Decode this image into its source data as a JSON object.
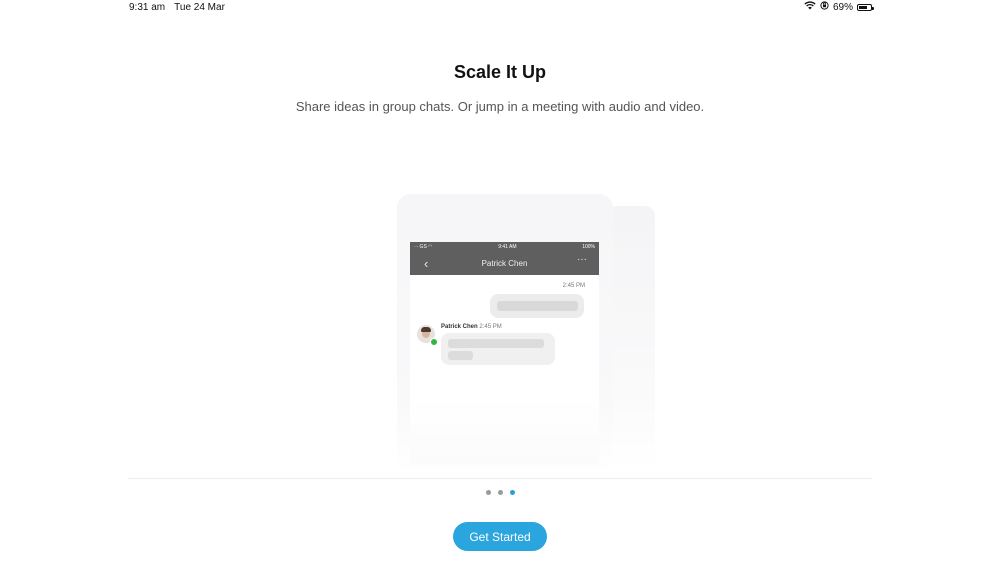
{
  "status_bar": {
    "time": "9:31 am",
    "date": "Tue 24 Mar",
    "battery_text": "69%",
    "battery_level": 0.69,
    "icons": [
      "wifi-icon",
      "orientation-lock-icon",
      "battery-icon"
    ]
  },
  "onboarding": {
    "title": "Scale It Up",
    "subtitle": "Share ideas in group chats. Or jump in a meeting with audio and video.",
    "illustration": {
      "status_left": "∙∙∙ GS ◠",
      "status_time": "9:41 AM",
      "status_battery": "100%",
      "chat_name": "Patrick Chen",
      "back_glyph": "‹",
      "more_glyph": "···",
      "outgoing_time": "2:45 PM",
      "sender_name": "Patrick Chen",
      "sender_time": "2:45 PM"
    },
    "page_indicator": {
      "count": 3,
      "active_index": 2
    },
    "cta_label": "Get Started"
  },
  "colors": {
    "accent": "#2aa5de",
    "active_dot": "#2a9fd6",
    "inactive_dot": "#9a9a9a",
    "header_bar": "#5f5f5f",
    "presence": "#2fb54a"
  }
}
